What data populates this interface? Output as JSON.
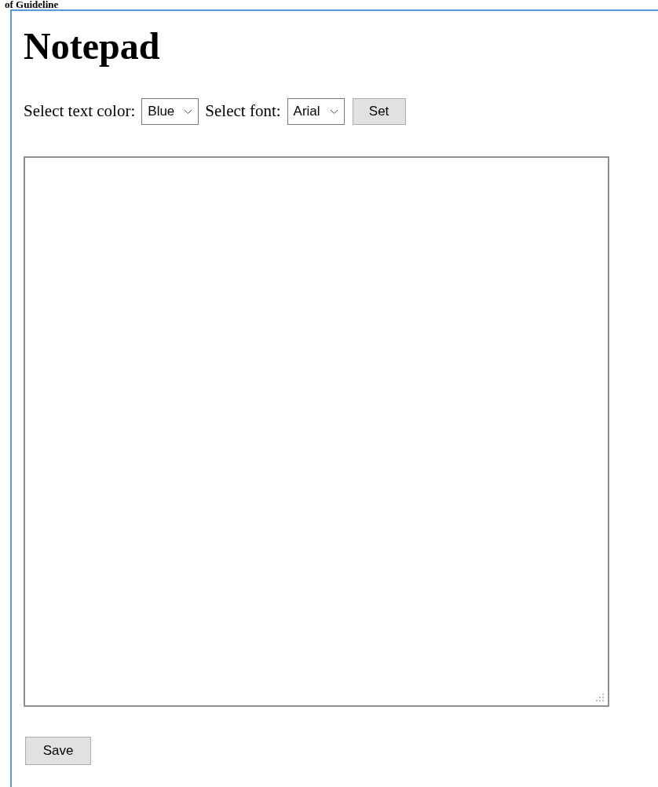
{
  "caption": "of Guideline",
  "title": "Notepad",
  "toolbar": {
    "color_label": "Select text color:",
    "color_value": "Blue",
    "font_label": "Select font:",
    "font_value": "Arial",
    "set_button": "Set"
  },
  "save_button": "Save"
}
